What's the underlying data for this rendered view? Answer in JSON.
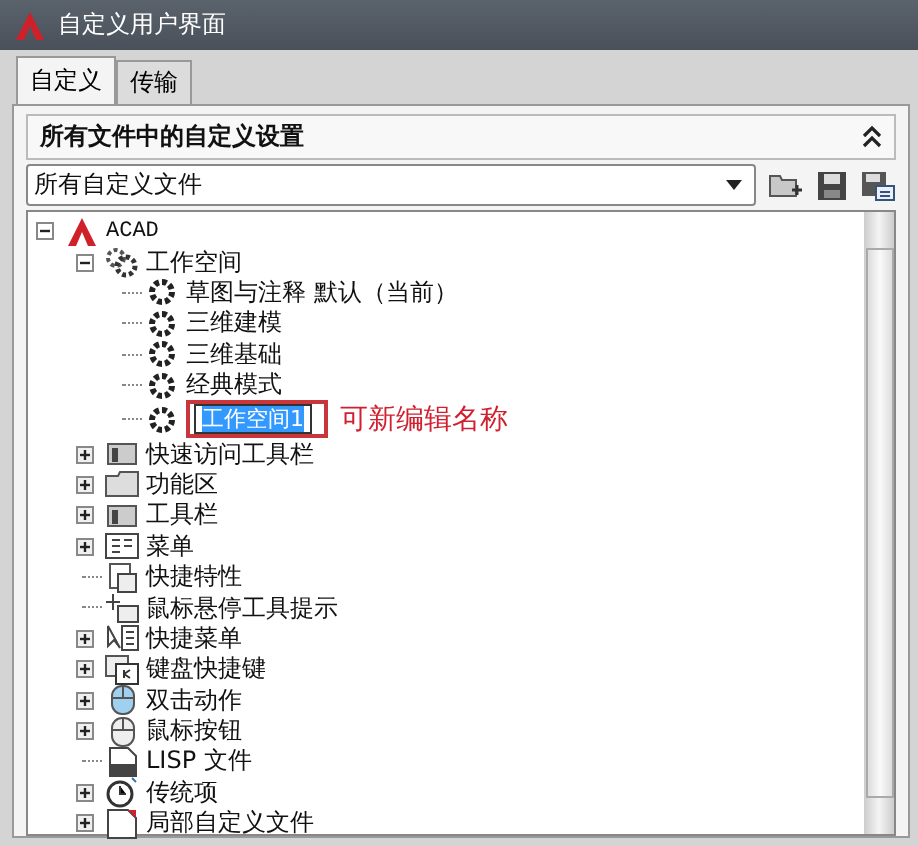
{
  "window": {
    "title": "自定义用户界面"
  },
  "tabs": [
    {
      "label": "自定义",
      "selected": true
    },
    {
      "label": "传输",
      "selected": false
    }
  ],
  "panel": {
    "title": "所有文件中的自定义设置",
    "expanded": true,
    "file_select": {
      "value": "所有自定义文件"
    }
  },
  "tree": [
    {
      "label": "ACAD",
      "kind": "acad",
      "expanded": true,
      "children": [
        {
          "label": "工作空间",
          "kind": "gears",
          "expanded": true,
          "children": [
            {
              "label": "草图与注释 默认（当前）",
              "kind": "gear"
            },
            {
              "label": "三维建模",
              "kind": "gear"
            },
            {
              "label": "三维基础",
              "kind": "gear"
            },
            {
              "label": "经典模式",
              "kind": "gear"
            },
            {
              "label": "工作空间1",
              "kind": "gear",
              "editing": true,
              "annotation": "可新编辑名称"
            }
          ]
        },
        {
          "label": "快速访问工具栏",
          "kind": "toolbar",
          "expanded": false
        },
        {
          "label": "功能区",
          "kind": "folder",
          "expanded": false
        },
        {
          "label": "工具栏",
          "kind": "toolbar",
          "expanded": false
        },
        {
          "label": "菜单",
          "kind": "menu",
          "expanded": false
        },
        {
          "label": "快捷特性",
          "kind": "properties"
        },
        {
          "label": "鼠标悬停工具提示",
          "kind": "tooltip"
        },
        {
          "label": "快捷菜单",
          "kind": "shortcut",
          "expanded": false
        },
        {
          "label": "键盘快捷键",
          "kind": "keyboard",
          "expanded": false
        },
        {
          "label": "双击动作",
          "kind": "mouse-blue",
          "expanded": false
        },
        {
          "label": "鼠标按钮",
          "kind": "mouse",
          "expanded": false
        },
        {
          "label": "LISP 文件",
          "kind": "lisp"
        },
        {
          "label": "传统项",
          "kind": "clock",
          "expanded": false
        },
        {
          "label": "局部自定义文件",
          "kind": "file",
          "expanded": false
        }
      ]
    }
  ]
}
